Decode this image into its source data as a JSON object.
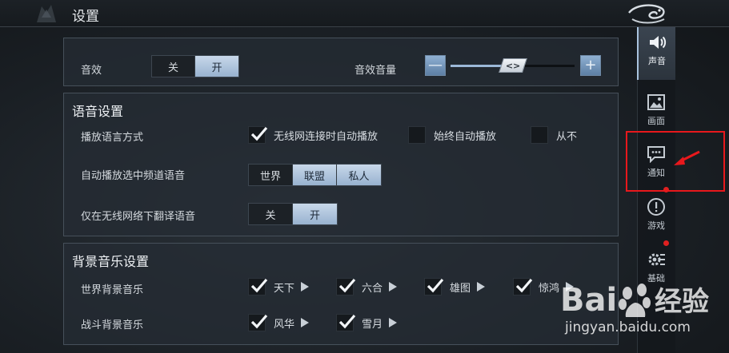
{
  "header": {
    "title": "设置"
  },
  "sound_panel": {
    "sound_effects_label": "音效",
    "sound_effects_options": [
      "关",
      "开"
    ],
    "sound_effects_selected": "开",
    "sfx_volume_label": "音效音量",
    "sfx_volume_level": 0.5,
    "volume_decrease": "—",
    "volume_increase": "+",
    "knob_glyph": "<>"
  },
  "voice_panel": {
    "title": "语音设置",
    "playback_mode_label": "播放语言方式",
    "playback_options": [
      {
        "label": "无线网连接时自动播放",
        "checked": true
      },
      {
        "label": "始终自动播放",
        "checked": false
      },
      {
        "label": "从不",
        "checked": false
      }
    ],
    "auto_play_channel_label": "自动播放选中频道语音",
    "channel_options": [
      "世界",
      "联盟",
      "私人"
    ],
    "channel_selected": [
      "联盟",
      "私人"
    ],
    "wifi_translate_label": "仅在无线网络下翻译语音",
    "wifi_translate_options": [
      "关",
      "开"
    ],
    "wifi_translate_selected": "开"
  },
  "music_panel": {
    "title": "背景音乐设置",
    "world_music_label": "世界背景音乐",
    "world_tracks": [
      {
        "label": "天下",
        "checked": true
      },
      {
        "label": "六合",
        "checked": true
      },
      {
        "label": "雄图",
        "checked": true
      },
      {
        "label": "惊鸿",
        "checked": true
      }
    ],
    "battle_music_label": "战斗背景音乐",
    "battle_tracks": [
      {
        "label": "风华",
        "checked": true
      },
      {
        "label": "雪月",
        "checked": true
      }
    ]
  },
  "sidebar": {
    "items": [
      {
        "label": "声音",
        "icon": "speaker-icon",
        "active": true
      },
      {
        "label": "画面",
        "icon": "picture-icon",
        "active": false
      },
      {
        "label": "通知",
        "icon": "chat-bubble-icon",
        "active": false,
        "badge": true
      },
      {
        "label": "游戏",
        "icon": "exclamation-circle-icon",
        "active": false
      },
      {
        "label": "基础",
        "icon": "gear-icon",
        "active": false,
        "badge": true
      }
    ]
  },
  "watermark": {
    "text": "jingyan.baidu.com",
    "logo_text": "Bai经验"
  },
  "colors": {
    "accent": "#98b2cf",
    "annotation": "#e8181c",
    "badge": "#e02020"
  }
}
